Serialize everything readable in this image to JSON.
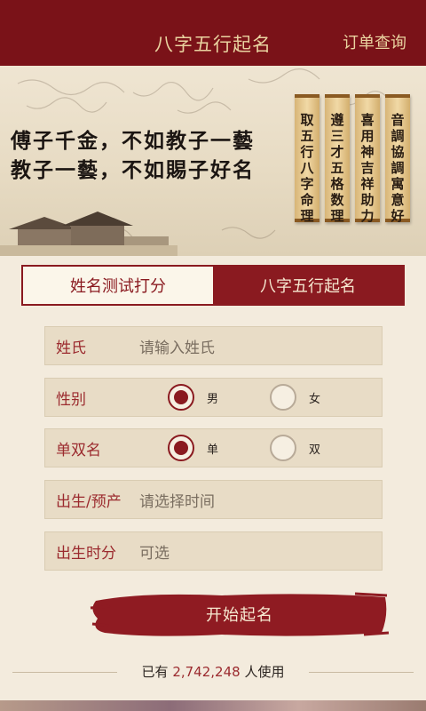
{
  "header": {
    "title": "八字五行起名",
    "order_link": "订单查询"
  },
  "banner": {
    "slogan_line1": "傅子千金，不如教子一藝",
    "slogan_line2": "教子一藝，不如賜子好名",
    "scrolls": [
      "取五行八字命理",
      "遵三才五格数理",
      "喜用神吉祥助力",
      "音調協調寓意好"
    ]
  },
  "tabs": [
    {
      "label": "姓名测试打分",
      "active": false
    },
    {
      "label": "八字五行起名",
      "active": true
    }
  ],
  "form": {
    "surname_label": "姓氏",
    "surname_placeholder": "请输入姓氏",
    "gender_label": "性别",
    "gender_options": [
      "男",
      "女"
    ],
    "gender_selected": "男",
    "name_type_label": "单双名",
    "name_type_options": [
      "单",
      "双"
    ],
    "name_type_selected": "单",
    "birth_label": "出生/预产",
    "birth_placeholder": "请选择时间",
    "birth_hour_label": "出生时分",
    "birth_hour_placeholder": "可选"
  },
  "start_button": "开始起名",
  "footer": {
    "prefix": "已有",
    "count": "2,742,248",
    "suffix": "人使用"
  },
  "colors": {
    "primary": "#8a1a20",
    "header_bg": "#7a1218",
    "page_bg": "#f3ebdd",
    "label": "#9b2a2e"
  }
}
